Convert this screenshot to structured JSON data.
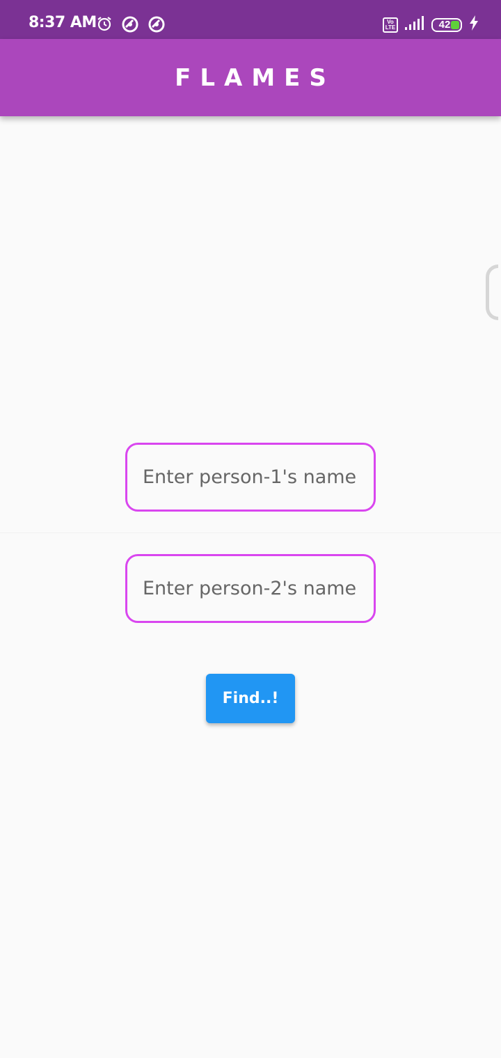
{
  "status_bar": {
    "time": "8:37 AM",
    "network_badge": "Vo LTE",
    "battery_level": "42",
    "icons": [
      "alarm-icon",
      "data-saver-icon",
      "data-saver-icon",
      "volte-icon",
      "signal-icon",
      "battery-icon",
      "charging-icon"
    ]
  },
  "app_bar": {
    "title": "FLAMES"
  },
  "form": {
    "person1_placeholder": "Enter person-1's name",
    "person1_value": "",
    "person2_placeholder": "Enter person-2's name",
    "person2_value": "",
    "submit_label": "Find..!"
  },
  "colors": {
    "status_bar": "#7b3294",
    "app_bar": "#ab47bc",
    "input_border": "#d946ef",
    "button": "#2196f3",
    "background": "#fafafa"
  }
}
